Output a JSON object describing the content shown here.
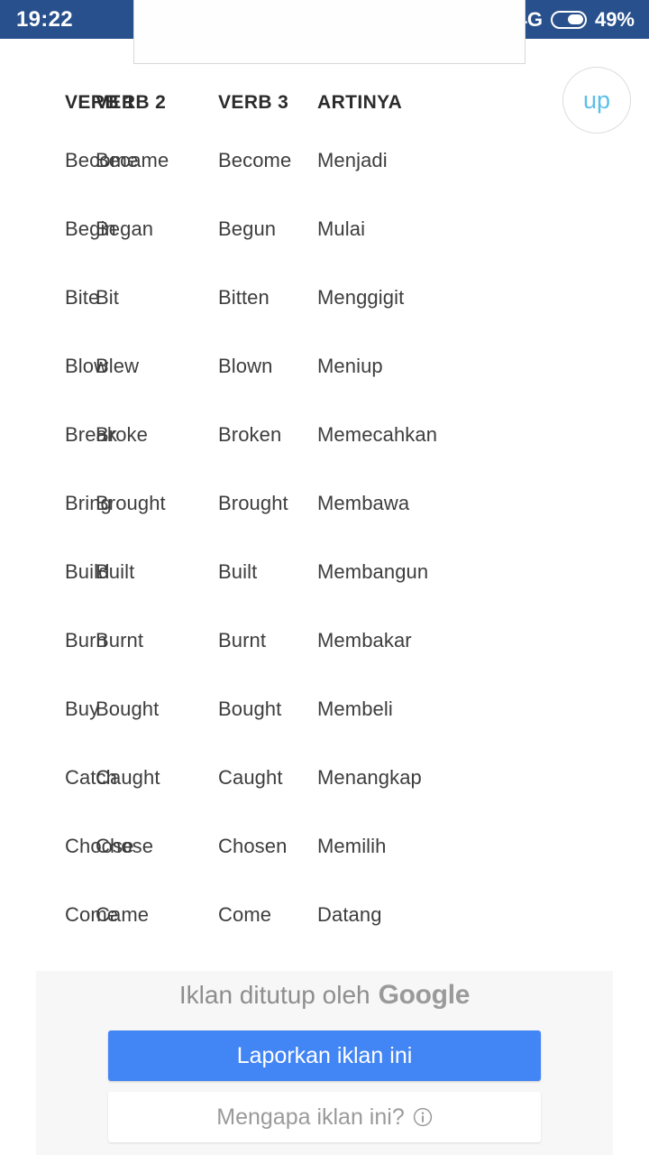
{
  "status_bar": {
    "clock": "19:22",
    "network_type": "4G",
    "battery_percent": "49%",
    "background_color": "#28508c",
    "icons": [
      "signal-bars-icon",
      "data-transfer-icon",
      "signal-bars-secondary-icon",
      "battery-icon"
    ]
  },
  "scroll_up_button": {
    "label": "up",
    "text_color": "#5bc0e8"
  },
  "table": {
    "columns": [
      "VERB 1",
      "VERB 2",
      "VERB 3",
      "ARTINYA"
    ],
    "rows": [
      [
        "Become",
        "Became",
        "Become",
        "Menjadi"
      ],
      [
        "Begin",
        "Began",
        "Begun",
        "Mulai"
      ],
      [
        "Bite",
        "Bit",
        "Bitten",
        "Menggigit"
      ],
      [
        "Blow",
        "Blew",
        "Blown",
        "Meniup"
      ],
      [
        "Break",
        "Broke",
        "Broken",
        "Memecahkan"
      ],
      [
        "Bring",
        "Brought",
        "Brought",
        "Membawa"
      ],
      [
        "Build",
        "Built",
        "Built",
        "Membangun"
      ],
      [
        "Burn",
        "Burnt",
        "Burnt",
        "Membakar"
      ],
      [
        "Buy",
        "Bought",
        "Bought",
        "Membeli"
      ],
      [
        "Catch",
        "Caught",
        "Caught",
        "Menangkap"
      ],
      [
        "Choose",
        "Chose",
        "Chosen",
        "Memilih"
      ],
      [
        "Come",
        "Came",
        "Come",
        "Datang"
      ]
    ]
  },
  "ad_footer": {
    "closed_by_text": "Iklan ditutup oleh",
    "brand": "Google",
    "report_button_label": "Laporkan iklan ini",
    "report_button_color": "#4285f4",
    "why_button_label": "Mengapa iklan ini?",
    "why_button_icon": "info-circle-icon"
  }
}
